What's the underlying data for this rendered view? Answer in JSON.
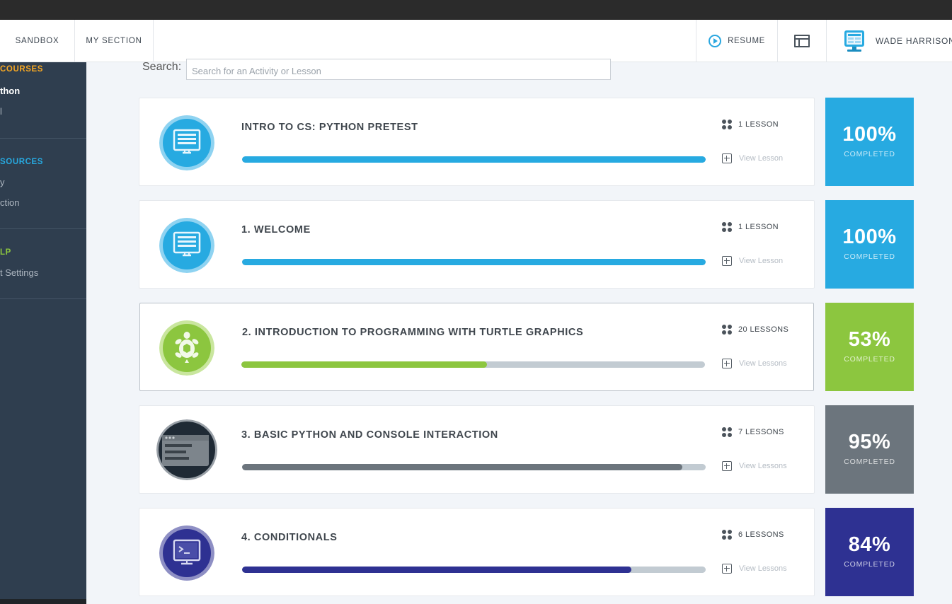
{
  "header": {
    "nav": [
      "SANDBOX",
      "MY SECTION"
    ],
    "resume_label": "RESUME",
    "user_name": "WADE HARRISON"
  },
  "sidebar": {
    "courses_heading": "COURSES",
    "course_item": "thon",
    "course_item_2": "l",
    "resources_heading": "SOURCES",
    "resource_items": [
      "y",
      "ction"
    ],
    "help_heading": "LP",
    "help_items": [
      "t Settings"
    ]
  },
  "search": {
    "label": "Search:",
    "placeholder": "Search for an Activity or Lesson",
    "value": ""
  },
  "modules": [
    {
      "title": "INTRO TO CS: PYTHON PRETEST",
      "lessons": "1 LESSON",
      "view": "View Lesson",
      "progress": 1.0,
      "percent": "100%",
      "completed": "COMPLETED",
      "color": "#27aae1",
      "icon": "monitor-icon"
    },
    {
      "title": "1. WELCOME",
      "lessons": "1 LESSON",
      "view": "View Lesson",
      "progress": 1.0,
      "percent": "100%",
      "completed": "COMPLETED",
      "color": "#27aae1",
      "icon": "monitor-icon"
    },
    {
      "title": "2. INTRODUCTION TO PROGRAMMING WITH TURTLE GRAPHICS",
      "lessons": "20 LESSONS",
      "view": "View Lessons",
      "progress": 0.53,
      "percent": "53%",
      "completed": "COMPLETED",
      "color": "#8cc63f",
      "icon": "turtle-icon"
    },
    {
      "title": "3. BASIC PYTHON AND CONSOLE INTERACTION",
      "lessons": "7 LESSONS",
      "view": "View Lessons",
      "progress": 0.95,
      "percent": "95%",
      "completed": "COMPLETED",
      "color": "#6c757d",
      "icon": "console-window-icon"
    },
    {
      "title": "4. CONDITIONALS",
      "lessons": "6 LESSONS",
      "view": "View Lessons",
      "progress": 0.84,
      "percent": "84%",
      "completed": "COMPLETED",
      "color": "#2e3192",
      "icon": "terminal-icon"
    }
  ],
  "colors": {
    "accent_blue": "#27aae1",
    "accent_green": "#8cc63f",
    "accent_gray": "#6c757d",
    "accent_navy": "#2e3192",
    "sidebar_bg": "#2f3e4f",
    "courses_heading": "#f7a823",
    "resources_heading": "#27aae1",
    "help_heading": "#8cc63f"
  }
}
